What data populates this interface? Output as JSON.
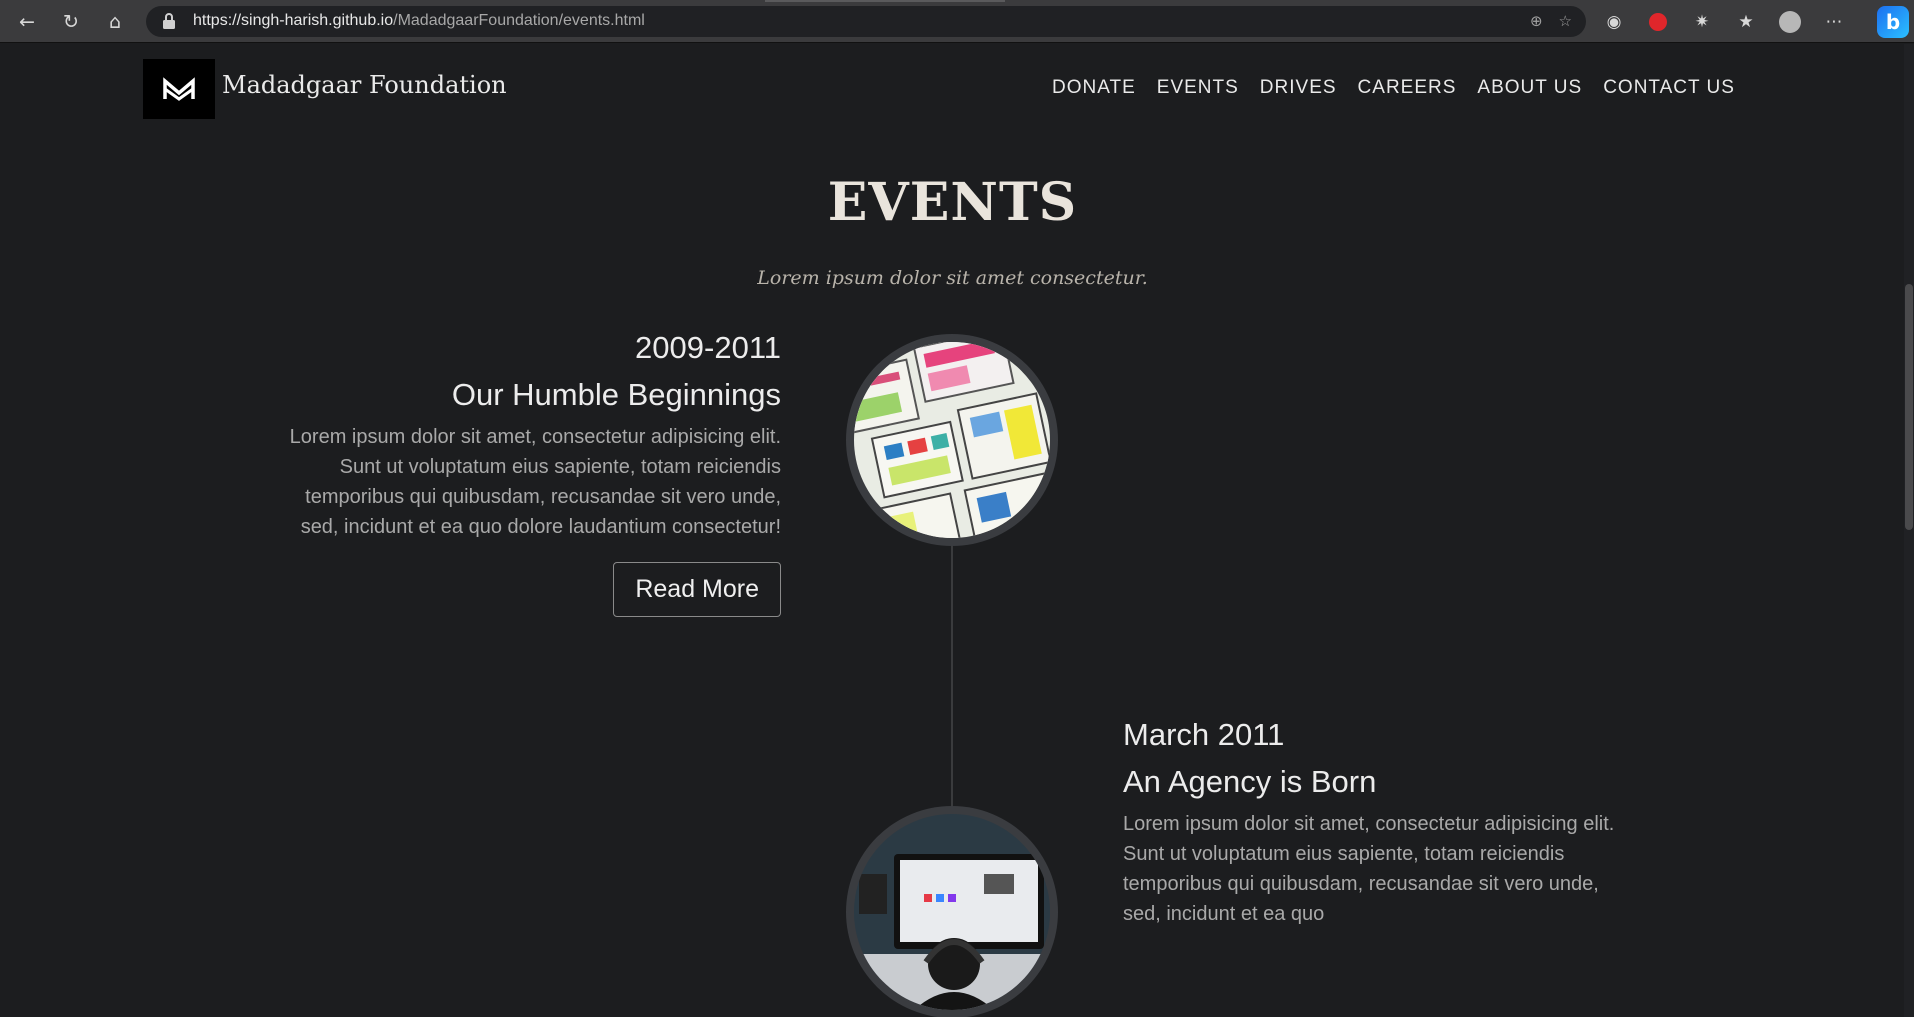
{
  "browser": {
    "url_host": "https://singh-harish.github.io",
    "url_path": "/MadadgaarFoundation/events.html"
  },
  "site": {
    "brand": "Madadgaar Foundation",
    "nav": [
      "DONATE",
      "EVENTS",
      "DRIVES",
      "CAREERS",
      "ABOUT US",
      "CONTACT US"
    ]
  },
  "section": {
    "title": "EVENTS",
    "subtitle": "Lorem ipsum dolor sit amet consectetur."
  },
  "events": [
    {
      "date": "2009-2011",
      "title": "Our Humble Beginnings",
      "body": "Lorem ipsum dolor sit amet, consectetur adipisicing elit. Sunt ut voluptatum eius sapiente, totam reiciendis temporibus qui quibusdam, recusandae sit vero unde, sed, incidunt et ea quo dolore laudantium consectetur!",
      "button": "Read More"
    },
    {
      "date": "March 2011",
      "title": "An Agency is Born",
      "body": "Lorem ipsum dolor sit amet, consectetur adipisicing elit. Sunt ut voluptatum eius sapiente, totam reiciendis temporibus qui quibusdam, recusandae sit vero unde, sed, incidunt et ea quo"
    }
  ],
  "colors": {
    "page_bg": "#1c1d1f",
    "heading": "#e9e4dc",
    "text_muted": "#a9a9a9"
  }
}
